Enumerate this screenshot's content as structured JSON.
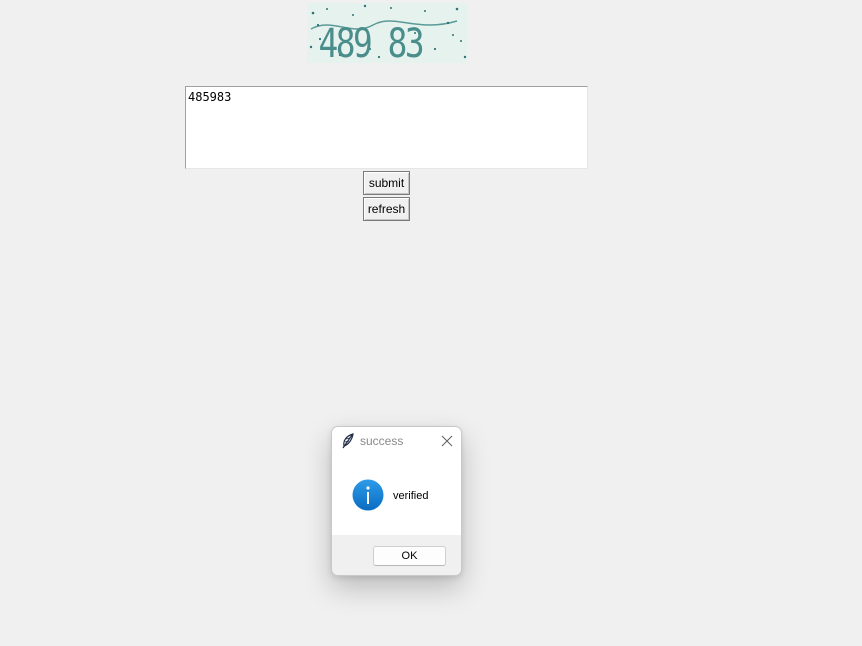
{
  "captcha": {
    "text": "489 83"
  },
  "answer": {
    "value": "485983"
  },
  "buttons": {
    "submit_label": "submit",
    "refresh_label": "refresh"
  },
  "dialog": {
    "title": "success",
    "message": "verified",
    "ok_label": "OK",
    "icons": {
      "app": "feather-icon",
      "close": "close-icon",
      "status": "info-icon"
    },
    "colors": {
      "info_icon": "#0f7ed6",
      "title_text": "#8a8a8a"
    }
  },
  "colors": {
    "window_background": "#f0f0f0",
    "captcha_background": "#e6f2ee",
    "captcha_text": "#4a8e8c"
  }
}
